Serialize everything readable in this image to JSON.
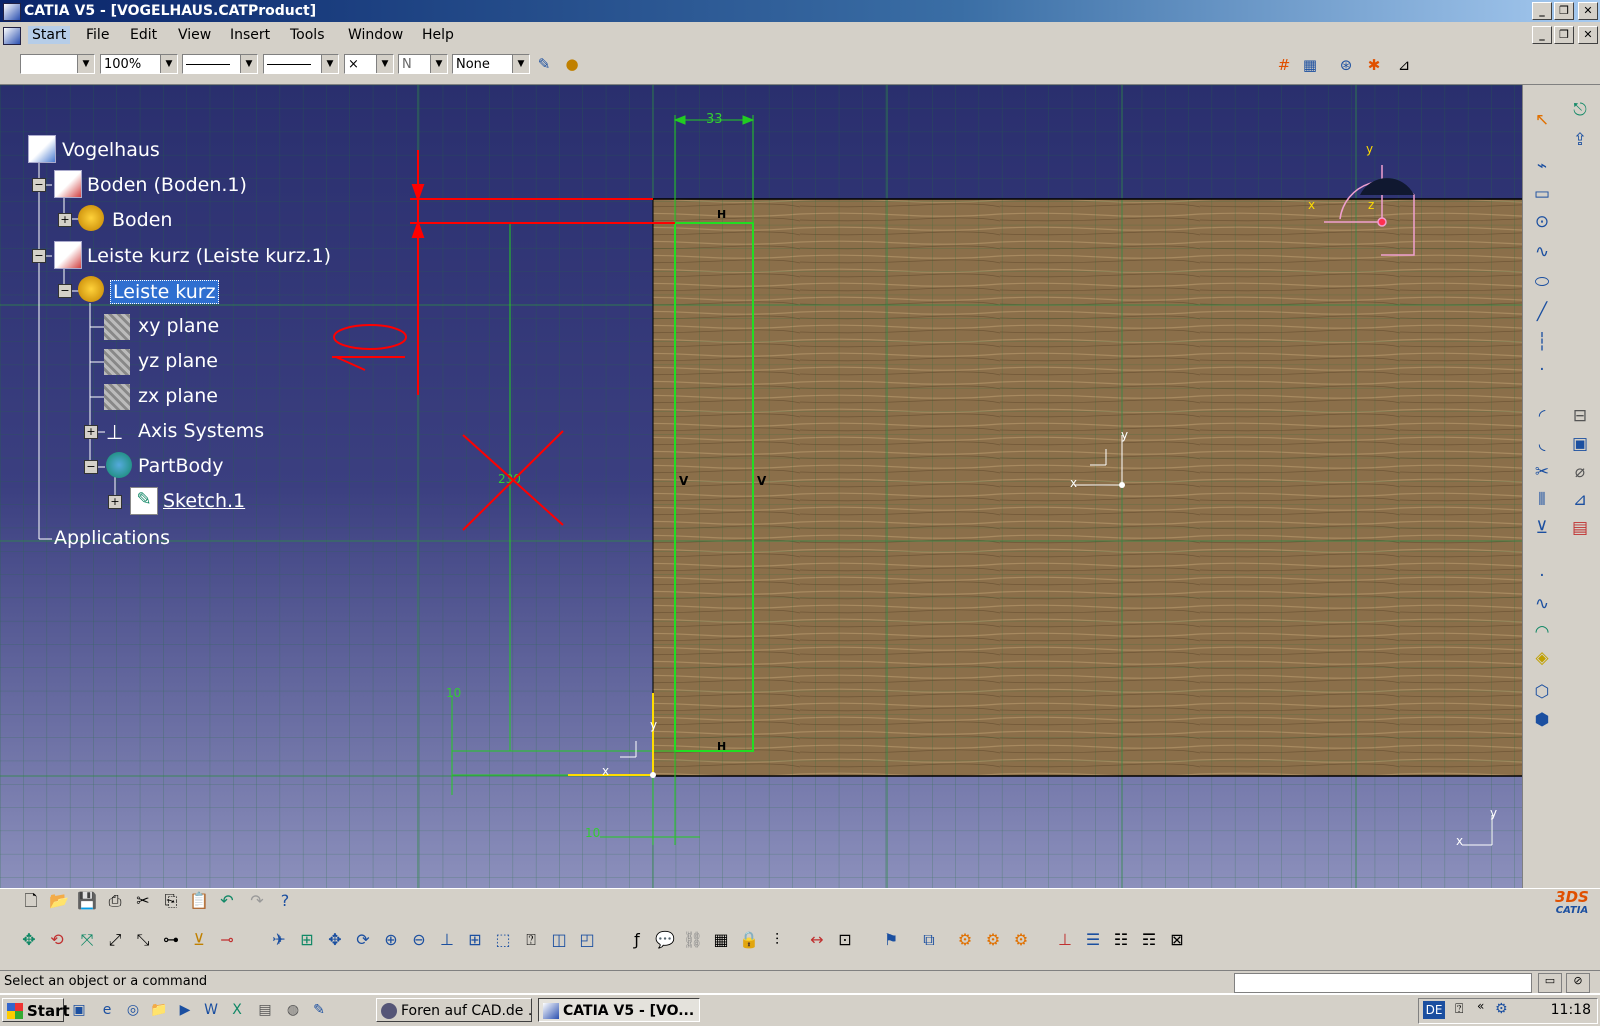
{
  "window": {
    "title": "CATIA V5 - [VOGELHAUS.CATProduct]",
    "buttons": [
      "_",
      "❐",
      "✕"
    ]
  },
  "menu": [
    "Start",
    "File",
    "Edit",
    "View",
    "Insert",
    "Tools",
    "Window",
    "Help"
  ],
  "toolbar1": {
    "zoom": "100%",
    "none_option": "None",
    "point_style": "×",
    "layer_value": "N"
  },
  "tree": {
    "root": "Vogelhaus",
    "nodes": [
      "Boden (Boden.1)",
      "Boden",
      "Leiste kurz (Leiste kurz.1)",
      "Leiste kurz",
      "xy plane",
      "yz plane",
      "zx plane",
      "Axis Systems",
      "PartBody",
      "Sketch.1",
      "Applications"
    ],
    "selected": "Leiste kurz"
  },
  "sketch": {
    "dims": [
      "33",
      "10",
      "10",
      "230"
    ],
    "constraints": [
      "H",
      "H",
      "V",
      "V"
    ],
    "annotation": "10",
    "axis_labels": [
      "x",
      "y",
      "z"
    ]
  },
  "brand": "CATIA",
  "status": {
    "message": "Select an object or a command"
  },
  "taskbar": {
    "start": "Start",
    "tasks": [
      "Foren auf CAD.de ...",
      "CATIA V5 - [VO..."
    ],
    "language": "DE",
    "clock": "11:18"
  },
  "colors": {
    "viewport_top": "#2a2f6e",
    "wood": "#8b6f4a",
    "sketch_green": "#22dd22",
    "annotation_red": "#ff0000",
    "selection": "#2f6fd0"
  }
}
